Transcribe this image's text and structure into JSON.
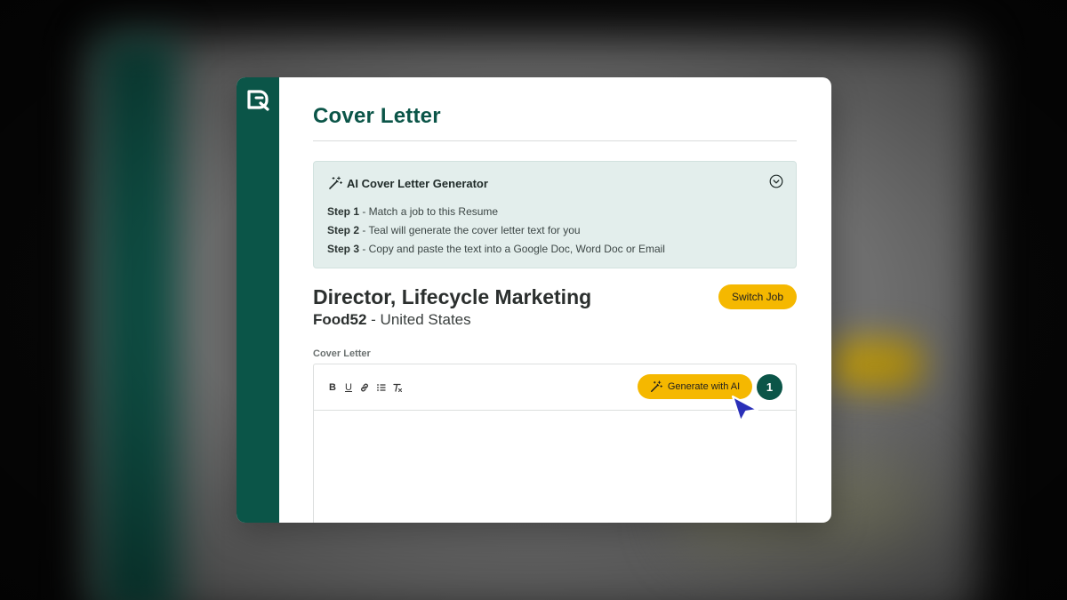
{
  "modal": {
    "title": "Cover Letter",
    "ai_panel": {
      "heading": "AI Cover Letter Generator",
      "steps": [
        {
          "label": "Step 1",
          "text": " - Match a job to this Resume"
        },
        {
          "label": "Step 2",
          "text": " - Teal will generate the cover letter text for you"
        },
        {
          "label": "Step 3",
          "text": " - Copy and paste the text into a Google Doc, Word Doc or Email"
        }
      ],
      "icon": "magic-wand-icon",
      "toggle_icon": "chevron-down-circle-icon"
    },
    "job": {
      "title": "Director, Lifecycle Marketing",
      "company": "Food52",
      "location": " - United States",
      "switch_label": "Switch Job"
    },
    "editor": {
      "label": "Cover Letter",
      "toolbar": {
        "bold": "B",
        "underline": "U",
        "link_icon": "link-icon",
        "list_icon": "bullet-list-icon",
        "clear_icon": "clear-format-icon"
      },
      "generate_label": "Generate with AI",
      "step_badge": "1",
      "content": ""
    }
  },
  "colors": {
    "brand_green": "#0b5548",
    "accent_yellow": "#f5b800",
    "panel_bg": "#e3eeec",
    "cursor_blue": "#2a2fb8"
  }
}
